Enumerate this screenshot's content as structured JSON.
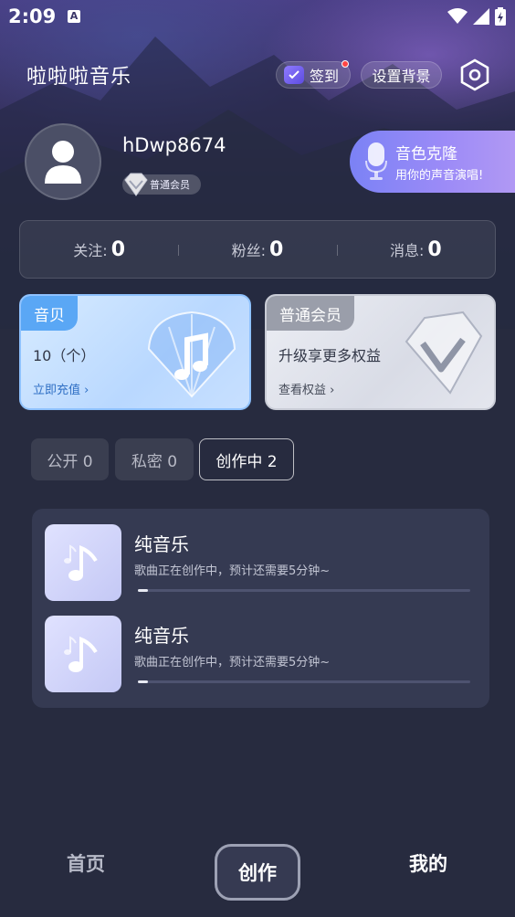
{
  "status_bar": {
    "time": "2:09",
    "notification_icon_letter": "A"
  },
  "header": {
    "app_title": "啦啦啦音乐",
    "checkin_label": "签到",
    "set_background_label": "设置背景"
  },
  "profile": {
    "username": "hDwp8674",
    "member_badge": "普通会员"
  },
  "voice_clone": {
    "title": "音色克隆",
    "subtitle": "用你的声音演唱!"
  },
  "stats": [
    {
      "label": "关注:",
      "value": "0"
    },
    {
      "label": "粉丝:",
      "value": "0"
    },
    {
      "label": "消息:",
      "value": "0"
    }
  ],
  "cards": {
    "coin": {
      "tag": "音贝",
      "main": "10（个）",
      "link": "立即充值 ›"
    },
    "vip": {
      "tag": "普通会员",
      "main": "升级享更多权益",
      "link": "查看权益 ›"
    }
  },
  "tabs": [
    {
      "label": "公开 0"
    },
    {
      "label": "私密 0"
    },
    {
      "label": "创作中 2",
      "active": true
    }
  ],
  "songs": [
    {
      "title": "纯音乐",
      "status": "歌曲正在创作中，预计还需要5分钟~",
      "progress": 0.03
    },
    {
      "title": "纯音乐",
      "status": "歌曲正在创作中，预计还需要5分钟~",
      "progress": 0.03
    }
  ],
  "bottom_nav": {
    "home": "首页",
    "create": "创作",
    "mine": "我的"
  },
  "colors": {
    "accent_blue": "#5aa7f5",
    "voice_clone_gradient_start": "#7b82f5",
    "background": "#272b3f"
  }
}
